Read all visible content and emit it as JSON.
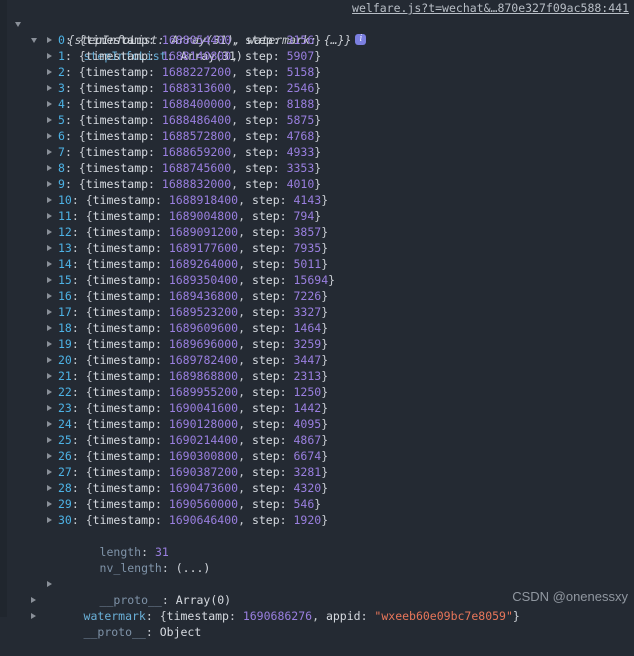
{
  "colors": {
    "background": "#242a33",
    "gutter": "#20262e",
    "property_key": "#6ab0d8",
    "property_key_dim": "#7f93a8",
    "number": "#9a7fe0",
    "string": "#e8765a",
    "index": "#4db3e6",
    "text": "#d6dae0",
    "link": "#b8bec6",
    "badge": "#7b7fe0",
    "watermark_text": "#9097a0"
  },
  "source_link": "welfare.js?t=wechat&…870e327f09ac588:441",
  "root_preview": {
    "text": "{stepInfoList: Array(31), watermark: {…}}",
    "badge_label": "i"
  },
  "step_info_list": {
    "key": "stepInfoList",
    "type": "Array(31)"
  },
  "entries": [
    {
      "index": "0",
      "timestamp": "1688054400",
      "step": "3156"
    },
    {
      "index": "1",
      "timestamp": "1688140800",
      "step": "5907"
    },
    {
      "index": "2",
      "timestamp": "1688227200",
      "step": "5158"
    },
    {
      "index": "3",
      "timestamp": "1688313600",
      "step": "2546"
    },
    {
      "index": "4",
      "timestamp": "1688400000",
      "step": "8188"
    },
    {
      "index": "5",
      "timestamp": "1688486400",
      "step": "5875"
    },
    {
      "index": "6",
      "timestamp": "1688572800",
      "step": "4768"
    },
    {
      "index": "7",
      "timestamp": "1688659200",
      "step": "4933"
    },
    {
      "index": "8",
      "timestamp": "1688745600",
      "step": "3353"
    },
    {
      "index": "9",
      "timestamp": "1688832000",
      "step": "4010"
    },
    {
      "index": "10",
      "timestamp": "1688918400",
      "step": "4143"
    },
    {
      "index": "11",
      "timestamp": "1689004800",
      "step": "794"
    },
    {
      "index": "12",
      "timestamp": "1689091200",
      "step": "3857"
    },
    {
      "index": "13",
      "timestamp": "1689177600",
      "step": "7935"
    },
    {
      "index": "14",
      "timestamp": "1689264000",
      "step": "5011"
    },
    {
      "index": "15",
      "timestamp": "1689350400",
      "step": "15694"
    },
    {
      "index": "16",
      "timestamp": "1689436800",
      "step": "7226"
    },
    {
      "index": "17",
      "timestamp": "1689523200",
      "step": "3327"
    },
    {
      "index": "18",
      "timestamp": "1689609600",
      "step": "1464"
    },
    {
      "index": "19",
      "timestamp": "1689696000",
      "step": "3259"
    },
    {
      "index": "20",
      "timestamp": "1689782400",
      "step": "3447"
    },
    {
      "index": "21",
      "timestamp": "1689868800",
      "step": "2313"
    },
    {
      "index": "22",
      "timestamp": "1689955200",
      "step": "1250"
    },
    {
      "index": "23",
      "timestamp": "1690041600",
      "step": "1442"
    },
    {
      "index": "24",
      "timestamp": "1690128000",
      "step": "4095"
    },
    {
      "index": "25",
      "timestamp": "1690214400",
      "step": "4867"
    },
    {
      "index": "26",
      "timestamp": "1690300800",
      "step": "6674"
    },
    {
      "index": "27",
      "timestamp": "1690387200",
      "step": "3281"
    },
    {
      "index": "28",
      "timestamp": "1690473600",
      "step": "4320"
    },
    {
      "index": "29",
      "timestamp": "1690560000",
      "step": "546"
    },
    {
      "index": "30",
      "timestamp": "1690646400",
      "step": "1920"
    }
  ],
  "array_meta": {
    "length_key": "length",
    "length_value": "31",
    "nv_length_key": "nv_length",
    "nv_length_value": "(...)",
    "proto_key": "__proto__",
    "proto_value": "Array(0)"
  },
  "watermark": {
    "key": "watermark",
    "timestamp_key": "timestamp",
    "timestamp_value": "1690686276",
    "appid_key": "appid",
    "appid_value": "\"wxeeb60e09bc7e8059\""
  },
  "root_proto": {
    "key": "__proto__",
    "value": "Object"
  },
  "csdn_watermark": "CSDN @onenessxy",
  "labels": {
    "timestamp_key": "timestamp",
    "step_key": "step",
    "open_brace": "{",
    "close_brace": "}",
    "colon_space": ": ",
    "comma_space": ", "
  }
}
